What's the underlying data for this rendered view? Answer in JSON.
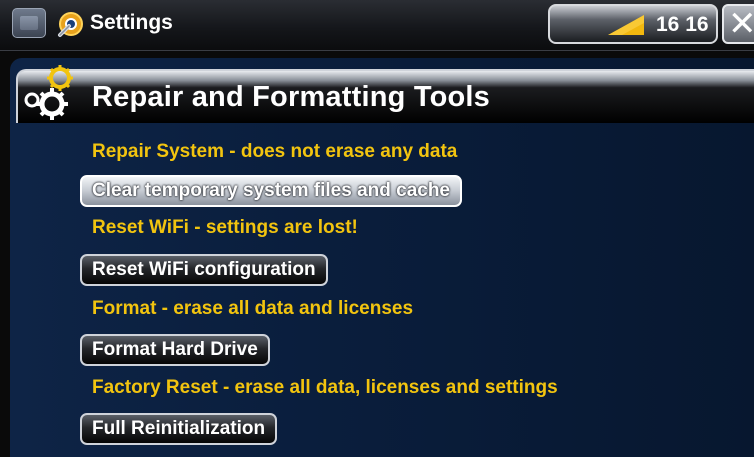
{
  "titlebar": {
    "title": "Settings",
    "clock": "16 16"
  },
  "section": {
    "title": "Repair and Formatting Tools"
  },
  "actions": [
    {
      "description": "Repair System - does not erase any data",
      "button_label": "Clear temporary system files and cache"
    },
    {
      "description": "Reset WiFi - settings are lost!",
      "button_label": "Reset WiFi configuration"
    },
    {
      "description": "Format - erase all data and licenses",
      "button_label": "Format Hard Drive"
    },
    {
      "description": "Factory Reset - erase all data, licenses and settings",
      "button_label": "Full Reinitialization"
    }
  ],
  "icons": [
    "home-icon",
    "settings-icon",
    "signal-strength-icon",
    "close-icon",
    "gears-icon"
  ],
  "colors": {
    "accent_yellow": "#f2c40f",
    "panel_blue": "#0a1e3d",
    "header_black": "#000000"
  }
}
